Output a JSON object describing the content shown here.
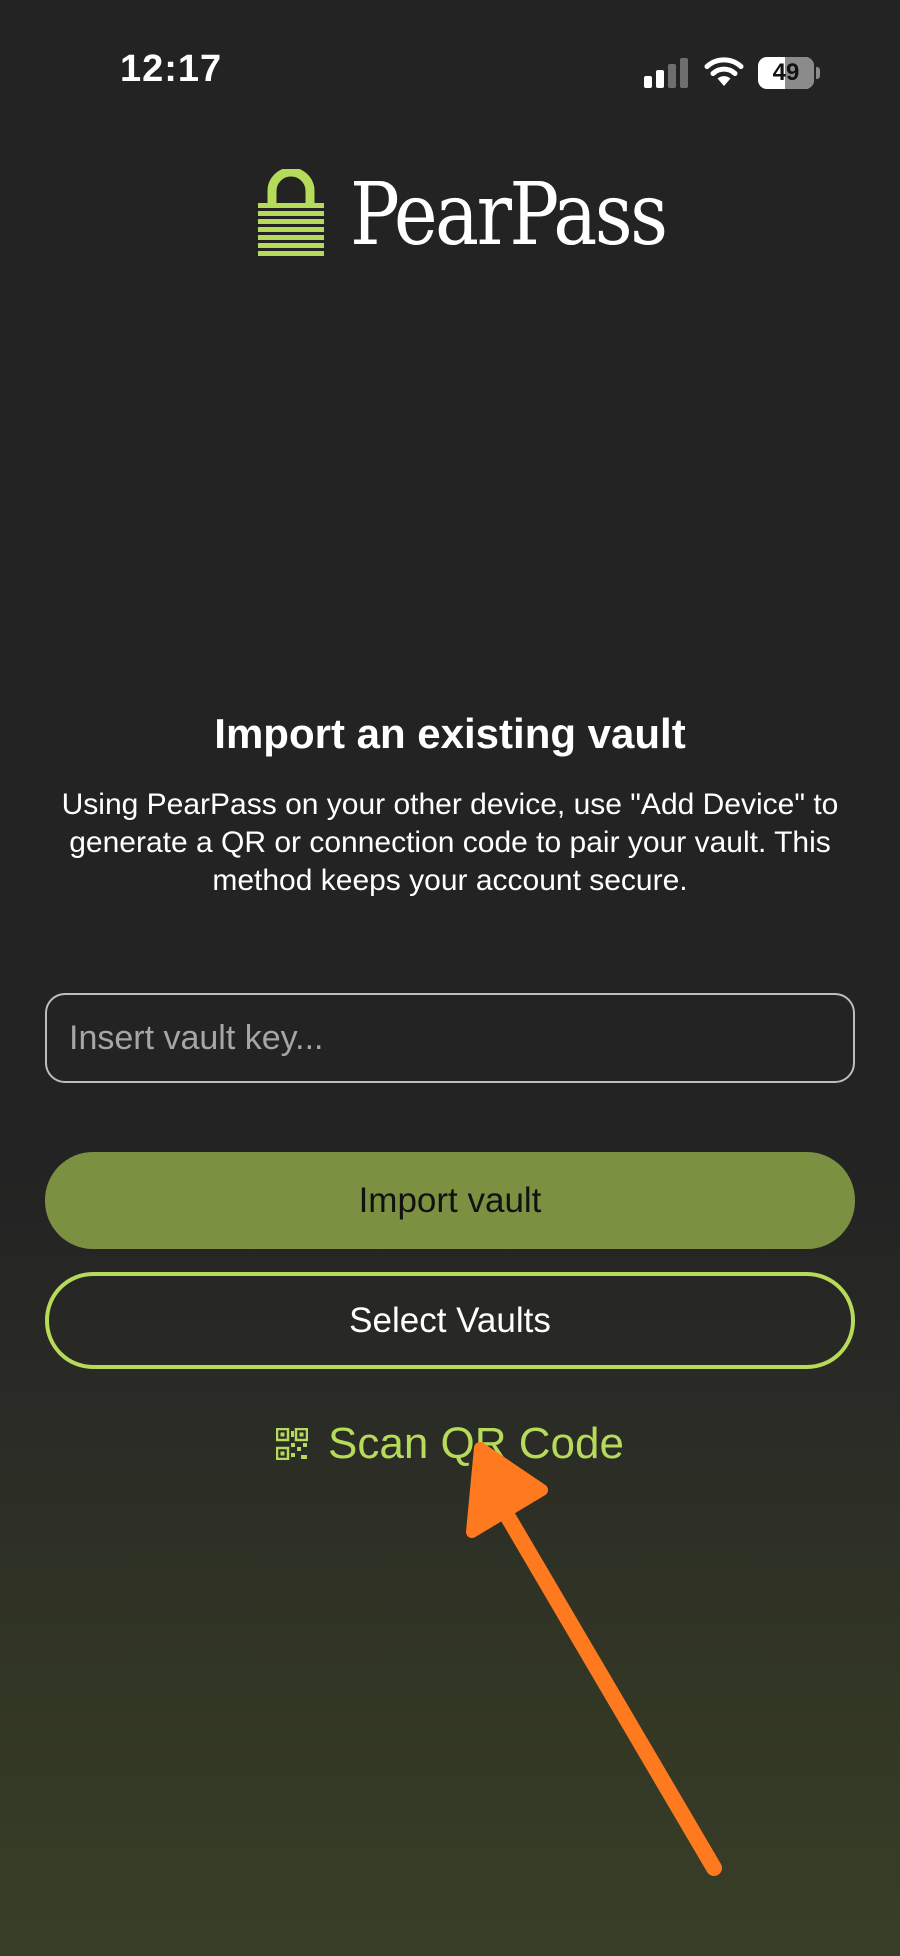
{
  "status_bar": {
    "time": "12:17",
    "battery_level": "49",
    "icons": [
      "cellular-signal-icon",
      "wifi-icon",
      "battery-icon"
    ]
  },
  "logo": {
    "brand": "PearPass",
    "icon": "padlock-icon"
  },
  "import_section": {
    "title": "Import an existing vault",
    "description": "Using PearPass on your other device, use \"Add Device\" to generate a QR or connection code to pair your vault. This method keeps your account secure.",
    "vault_key_input": {
      "placeholder": "Insert vault key...",
      "value": ""
    },
    "import_button_label": "Import vault",
    "select_vaults_label": "Select Vaults",
    "scan_qr_label": "Scan QR Code",
    "scan_qr_icon": "qr-code-icon"
  },
  "annotation": {
    "icon": "arrow-icon"
  },
  "colors": {
    "background": "#232323",
    "accent": "#b6da59",
    "primary_button": "#7b9141",
    "annotation_arrow": "#ff7a1f",
    "text": "#ffffff"
  }
}
